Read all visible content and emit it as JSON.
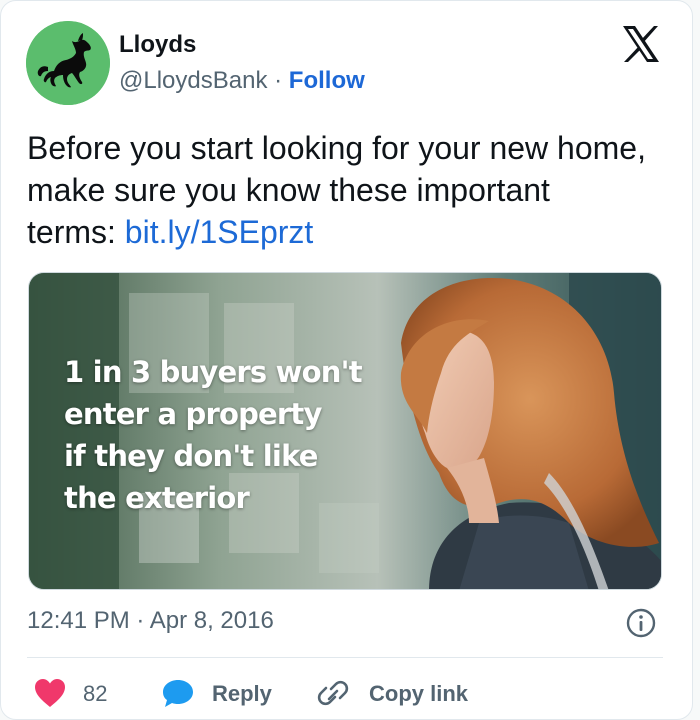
{
  "tweet": {
    "author_name": "Lloyds",
    "handle": "@LloydsBank",
    "separator": " · ",
    "follow_label": "Follow",
    "text": "Before you start looking for your new home, make sure you know these important terms: ",
    "link_text": "bit.ly/1SEprzt",
    "timestamp": "12:41 PM · Apr 8, 2016"
  },
  "media": {
    "overlay_lines": [
      "1 in 3 buyers won't",
      "enter a property",
      "if they don't like",
      "the exterior"
    ]
  },
  "actions": {
    "like_count": "82",
    "reply_label": "Reply",
    "copy_link_label": "Copy link"
  },
  "colors": {
    "brand_green": "#5bbd6d",
    "link_blue": "#1d6ad6",
    "like_pink": "#f0386b",
    "reply_blue": "#1d9bf0",
    "text_gray": "#536471"
  },
  "icons": {
    "avatar": "black-horse-logo",
    "platform": "x-logo-icon",
    "info": "info-icon",
    "like": "heart-icon",
    "reply": "speech-bubble-icon",
    "copy": "link-chain-icon"
  }
}
